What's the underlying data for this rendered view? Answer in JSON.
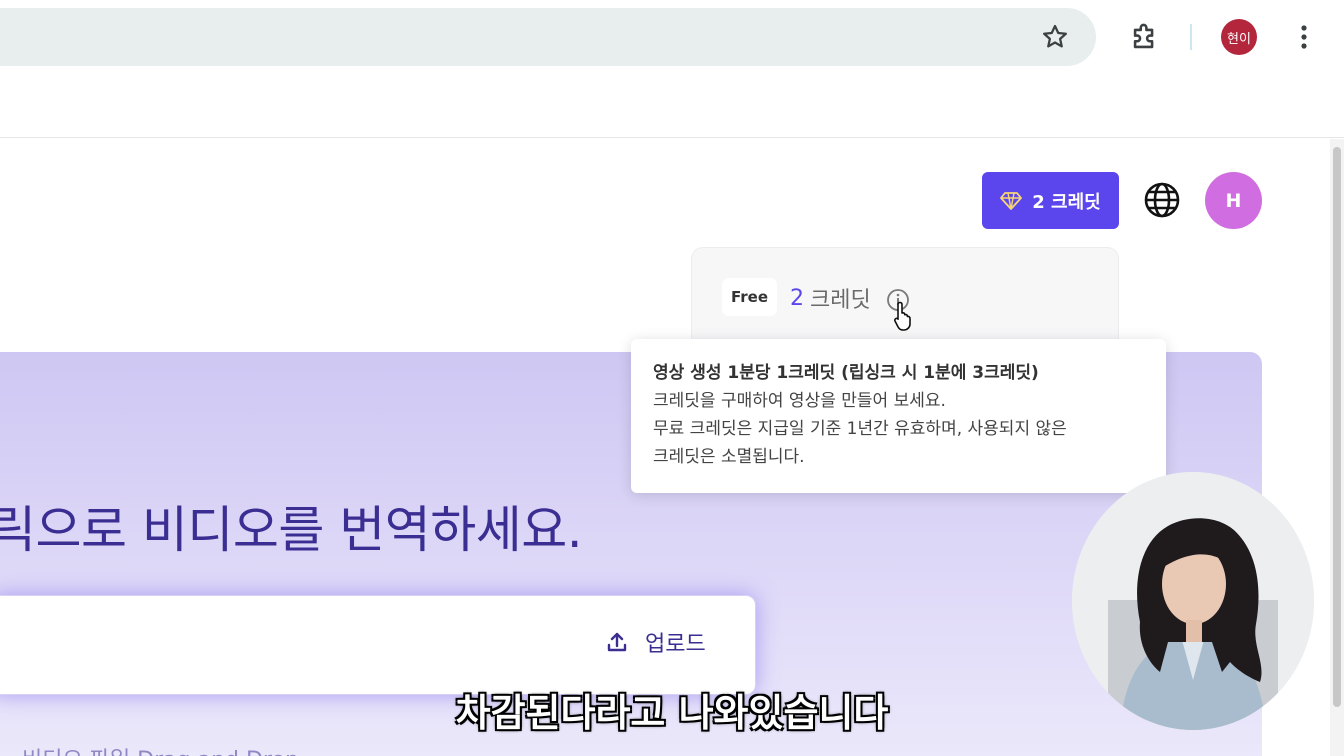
{
  "browser": {
    "profile_chip": "현이"
  },
  "header": {
    "credit_button": "2 크레딧",
    "avatar_initial": "H"
  },
  "credit_card": {
    "plan": "Free",
    "credits_number": "2",
    "credits_unit": "크레딧"
  },
  "tooltip": {
    "line1": "영상 생성 1분당 1크레딧 (립싱크 시 1분에 3크레딧)",
    "line2": "크레딧을 구매하여 영상을 만들어 보세요.",
    "line3": "무료 크레딧은 지급일 기준 1년간 유효하며, 사용되지 않은",
    "line4": "크레딧은 소멸됩니다."
  },
  "hero": {
    "title": "릭으로 비디오를 번역하세요.",
    "upload_label": "업로드",
    "drag_hint": "비디오 파일 Drag and Drop"
  },
  "caption": "차감된다라고 나와있습니다",
  "colors": {
    "accent": "#5b45ec",
    "hero_text": "#3b2e92",
    "profile_chip": "#b3263c",
    "avatar": "#d06de0"
  }
}
